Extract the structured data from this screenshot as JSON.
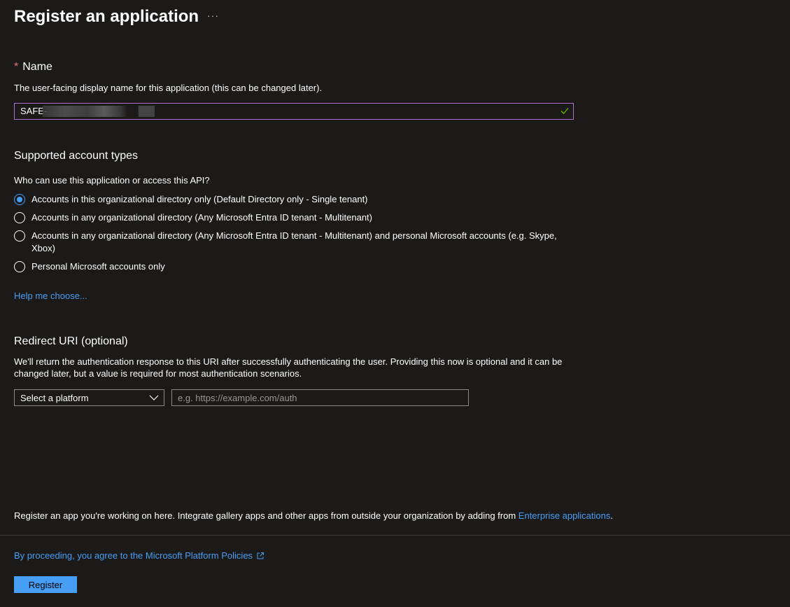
{
  "page": {
    "title": "Register an application",
    "more_label": "···"
  },
  "name_section": {
    "required_marker": "*",
    "label": "Name",
    "description": "The user-facing display name for this application (this can be changed later).",
    "value": "SAFE-"
  },
  "account_types": {
    "heading": "Supported account types",
    "question": "Who can use this application or access this API?",
    "options": [
      {
        "label": "Accounts in this organizational directory only (Default Directory only - Single tenant)",
        "selected": true
      },
      {
        "label": "Accounts in any organizational directory (Any Microsoft Entra ID tenant - Multitenant)",
        "selected": false
      },
      {
        "label": "Accounts in any organizational directory (Any Microsoft Entra ID tenant - Multitenant) and personal Microsoft accounts (e.g. Skype, Xbox)",
        "selected": false
      },
      {
        "label": "Personal Microsoft accounts only",
        "selected": false
      }
    ],
    "help_link": "Help me choose..."
  },
  "redirect": {
    "heading": "Redirect URI (optional)",
    "description": "We'll return the authentication response to this URI after successfully authenticating the user. Providing this now is optional and it can be changed later, but a value is required for most authentication scenarios.",
    "platform_select": "Select a platform",
    "uri_placeholder": "e.g. https://example.com/auth"
  },
  "footer": {
    "note_prefix": "Register an app you're working on here. Integrate gallery apps and other apps from outside your organization by adding from ",
    "note_link": "Enterprise applications",
    "note_suffix": ".",
    "policy_link": "By proceeding, you agree to the Microsoft Platform Policies",
    "register_label": "Register"
  },
  "colors": {
    "background": "#1b1a19",
    "accent": "#479ef5",
    "required": "#f1707b",
    "focused_border": "#b070d0",
    "valid_check": "#6bb700"
  },
  "icons": [
    "more-icon",
    "check-icon",
    "chevron-down-icon",
    "external-link-icon"
  ]
}
